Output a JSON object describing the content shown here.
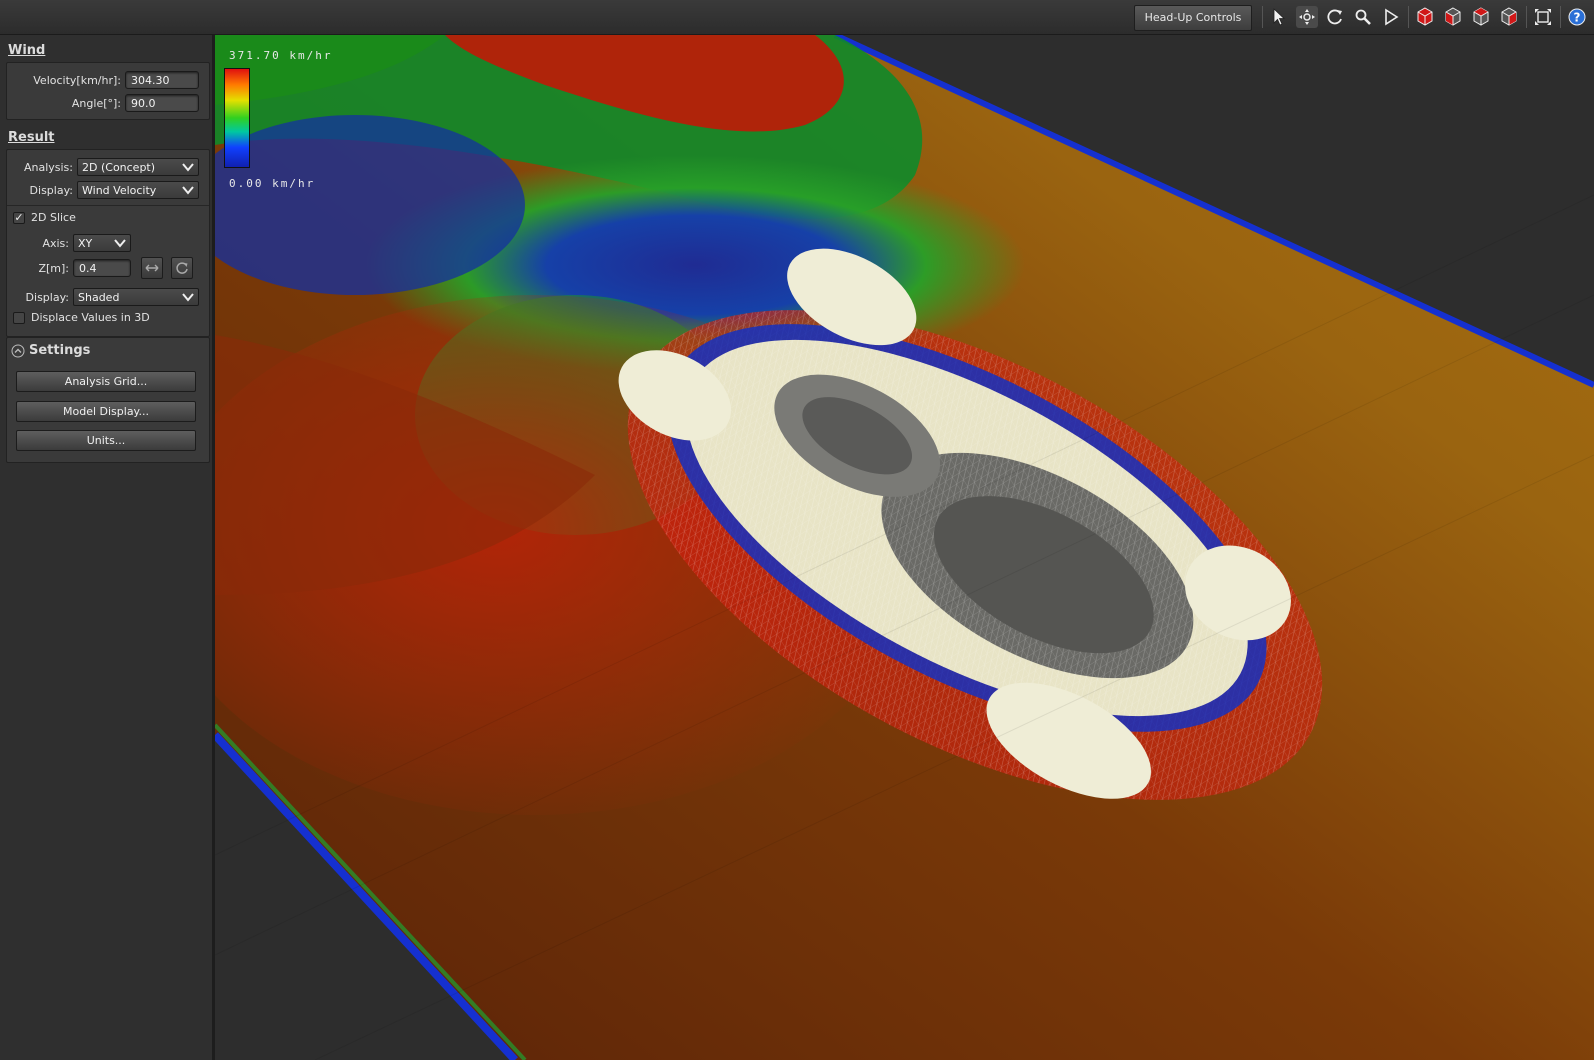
{
  "toolbar": {
    "hud_label": "Head-Up Controls",
    "icons": [
      "select-arrow-icon",
      "pan-icon",
      "orbit-icon",
      "zoom-icon",
      "play-icon",
      "cube-front-icon",
      "cube-side-icon",
      "cube-top-icon",
      "cube-iso-icon",
      "fit-view-icon",
      "help-icon"
    ]
  },
  "wind": {
    "title": "Wind",
    "velocity_label": "Velocity[km/hr]:",
    "velocity_value": "304.30",
    "angle_label": "Angle[°]:",
    "angle_value": "90.0"
  },
  "result": {
    "title": "Result",
    "analysis_label": "Analysis:",
    "analysis_value": "2D (Concept)",
    "display_label": "Display:",
    "display_value": "Wind Velocity",
    "slice_label": "2D Slice",
    "slice_checked": true,
    "axis_label": "Axis:",
    "axis_value": "XY",
    "z_label": "Z[m]:",
    "z_value": "0.4",
    "display2_label": "Display:",
    "display2_value": "Shaded",
    "displace_label": "Displace Values in 3D",
    "displace_checked": false
  },
  "settings": {
    "title": "Settings",
    "buttons": [
      "Analysis Grid...",
      "Model Display...",
      "Units..."
    ]
  },
  "legend": {
    "max": "371.70 km/hr",
    "min": "0.00 km/hr"
  }
}
